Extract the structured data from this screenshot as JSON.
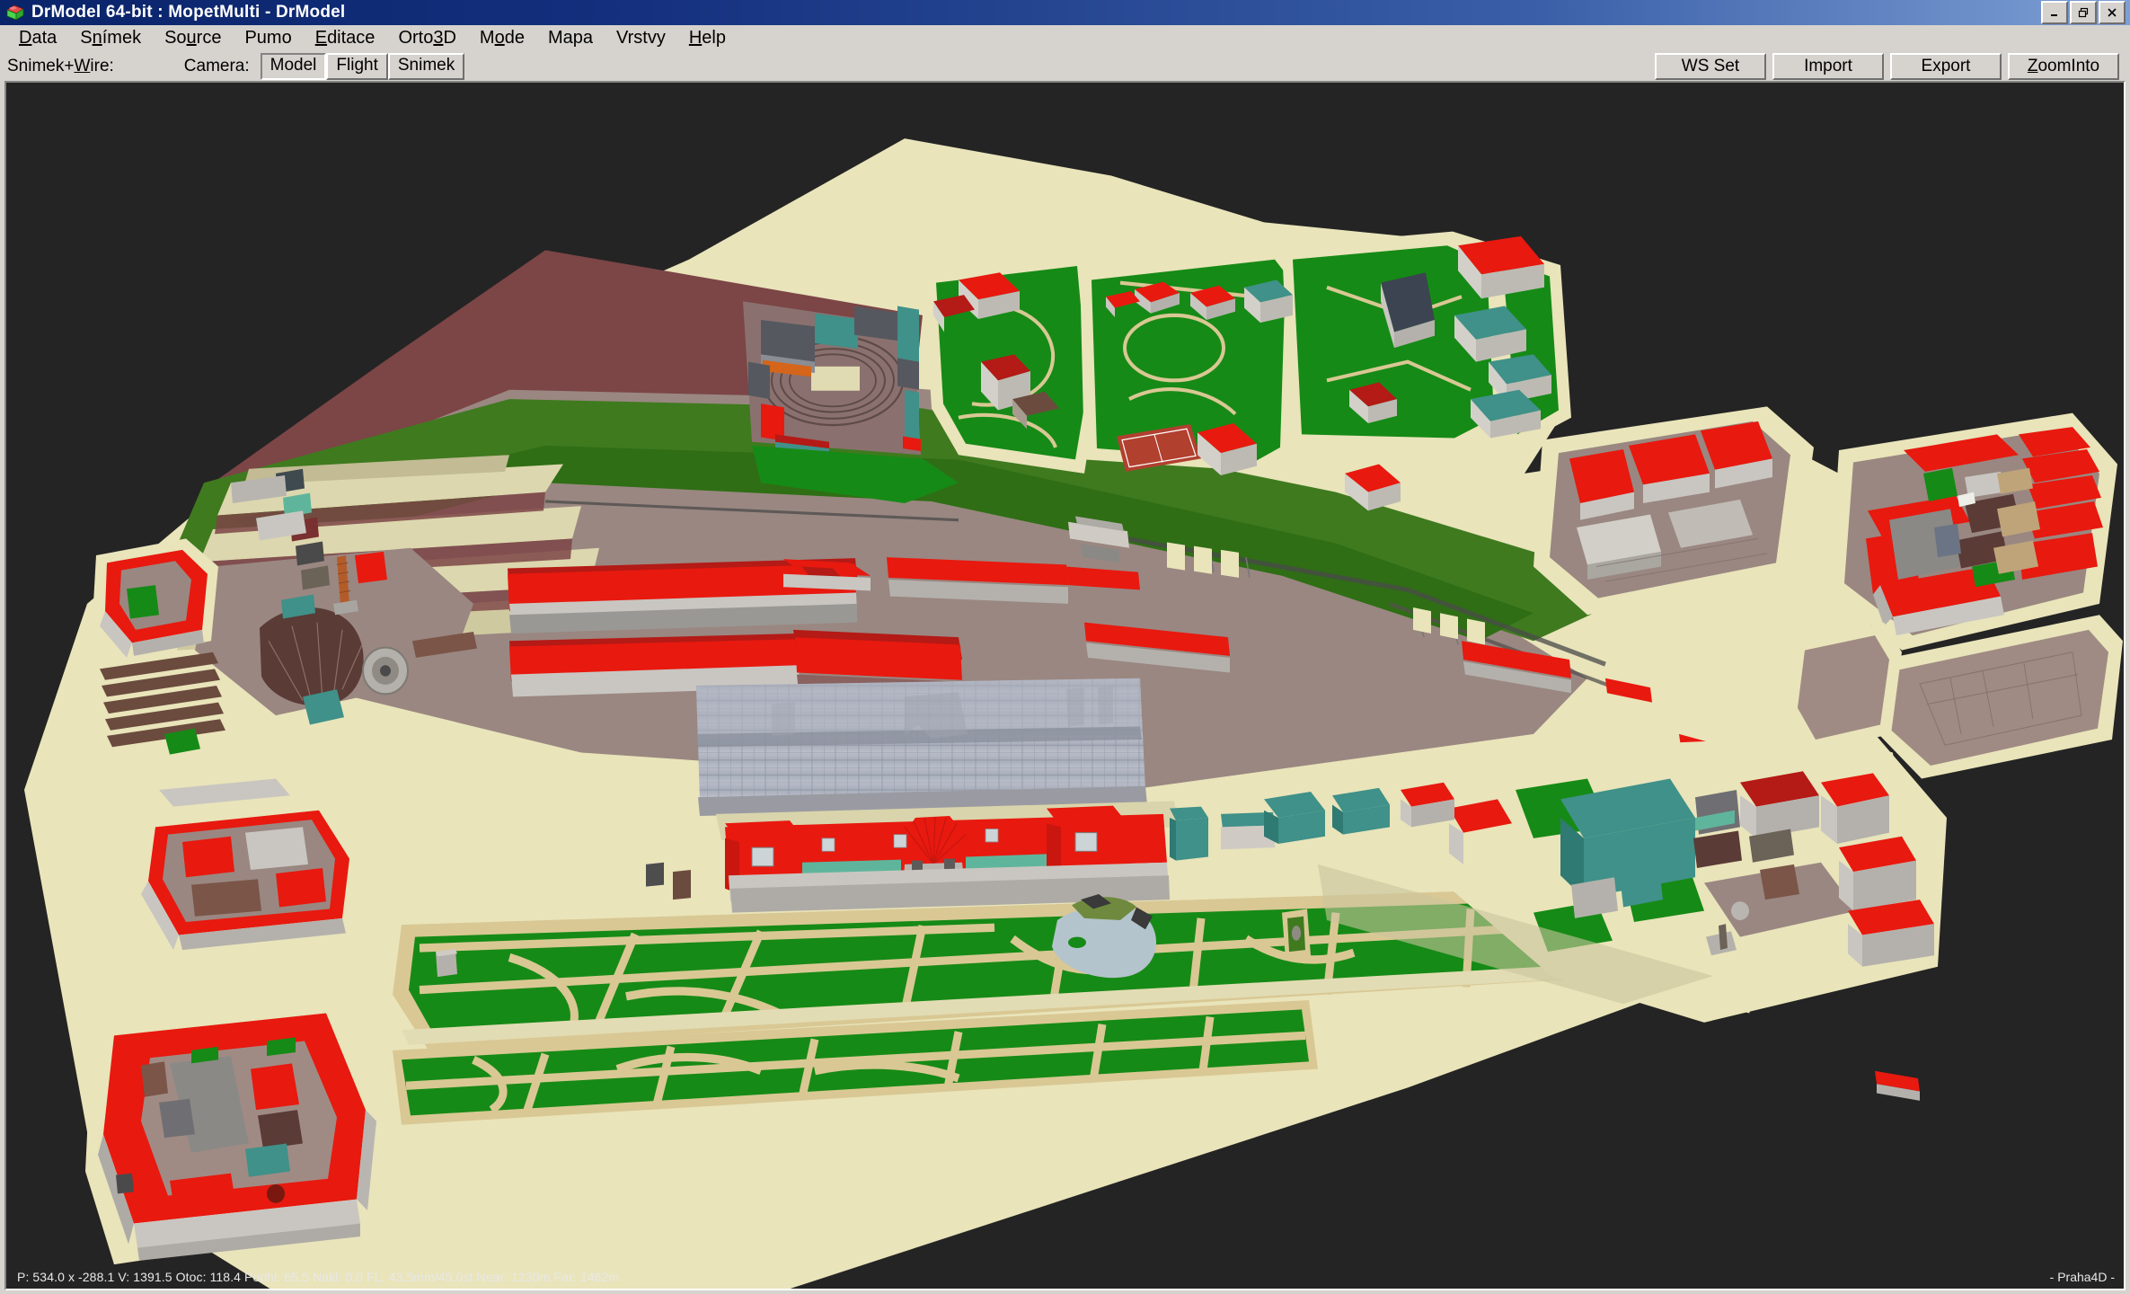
{
  "window": {
    "title": "DrModel 64-bit : MopetMulti - DrModel",
    "icon": "app-cube-icon",
    "controls": {
      "minimize": "_",
      "maximize": "❐",
      "close": "✕"
    }
  },
  "menubar": {
    "items": [
      {
        "label": "Data",
        "accel": "D"
      },
      {
        "label": "Snímek",
        "accel": "n"
      },
      {
        "label": "Source",
        "accel": "u"
      },
      {
        "label": "Pumo",
        "accel": ""
      },
      {
        "label": "Editace",
        "accel": "E"
      },
      {
        "label": "Orto3D",
        "accel": "3"
      },
      {
        "label": "Mode",
        "accel": "o"
      },
      {
        "label": "Mapa",
        "accel": ""
      },
      {
        "label": "Vrstvy",
        "accel": ""
      },
      {
        "label": "Help",
        "accel": "H"
      }
    ]
  },
  "toolbar": {
    "mode_label": "Snimek+Wire:",
    "camera_label": "Camera:",
    "camera_buttons": [
      {
        "label": "Model",
        "selected": true
      },
      {
        "label": "Flight",
        "selected": false
      },
      {
        "label": "Snimek",
        "selected": false
      }
    ],
    "right_buttons": [
      {
        "label": "WS Set",
        "accel": ""
      },
      {
        "label": "Import",
        "accel": ""
      },
      {
        "label": "Export",
        "accel": ""
      },
      {
        "label": "ZoomInto",
        "accel": "Z"
      }
    ]
  },
  "statusbar": {
    "text": "P: 534.0 x -288.1  V: 1391.5  Otoc: 118.4   Podhl: 65.5   Nakl: 0.0   FL: 43.5mm/45.0st   Near: 1230m   Far: 1462m",
    "fields": {
      "position": "P: 534.0 x -288.1",
      "height": "V: 1391.5",
      "rotation": "Otoc: 118.4",
      "pitch": "Podhl: 65.5",
      "roll": "Nakl: 0.0",
      "focal": "FL: 43.5mm/45.0st",
      "near": "Near: 1230m",
      "far": "Far: 1462m"
    },
    "project": "- Praha4D -"
  },
  "viewport": {
    "name": "3d-model-viewport",
    "background": "#242424",
    "scene_description": "Oblique aerial 3D city model of the Prague main railway station district",
    "colors": {
      "background": "#242424",
      "pavement": "#e9e4ba",
      "road_dark": "#9a8781",
      "roof_red": "#e8190f",
      "roof_red_dark": "#b41a16",
      "roof_teal": "#3f9189",
      "roof_grey": "#9aa0ad",
      "grass": "#168a16",
      "grass_dark": "#4f8420",
      "terrain_brown": "#7d4a4a",
      "wall_grey": "#c9c6c1",
      "water": "#b4c4cc",
      "sand": "#d9c894"
    }
  }
}
